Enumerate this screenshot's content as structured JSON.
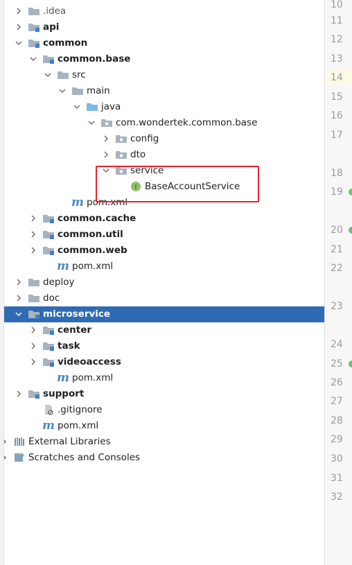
{
  "tree": {
    "rows": [
      {
        "label": ".idea",
        "indent": 0,
        "kind": "dir",
        "state": "collapsed",
        "bold": false,
        "muted": true
      },
      {
        "label": "api",
        "indent": 0,
        "kind": "module",
        "state": "collapsed",
        "bold": true
      },
      {
        "label": "common",
        "indent": 0,
        "kind": "module",
        "state": "expanded",
        "bold": true
      },
      {
        "label": "common.base",
        "indent": 1,
        "kind": "module",
        "state": "expanded",
        "bold": true
      },
      {
        "label": "src",
        "indent": 2,
        "kind": "dir",
        "state": "expanded",
        "bold": false
      },
      {
        "label": "main",
        "indent": 3,
        "kind": "dir",
        "state": "expanded",
        "bold": false
      },
      {
        "label": "java",
        "indent": 4,
        "kind": "source-root",
        "state": "expanded",
        "bold": false
      },
      {
        "label": "com.wondertek.common.base",
        "indent": 5,
        "kind": "package",
        "state": "expanded",
        "bold": false
      },
      {
        "label": "config",
        "indent": 6,
        "kind": "package",
        "state": "collapsed",
        "bold": false
      },
      {
        "label": "dto",
        "indent": 6,
        "kind": "package",
        "state": "collapsed",
        "bold": false
      },
      {
        "label": "service",
        "indent": 6,
        "kind": "package",
        "state": "expanded",
        "bold": false
      },
      {
        "label": "BaseAccountService",
        "indent": 7,
        "kind": "interface",
        "state": "leaf",
        "bold": false
      },
      {
        "label": "pom.xml",
        "indent": 3,
        "kind": "maven",
        "state": "leaf",
        "bold": false
      },
      {
        "label": "common.cache",
        "indent": 1,
        "kind": "module",
        "state": "collapsed",
        "bold": true
      },
      {
        "label": "common.util",
        "indent": 1,
        "kind": "module",
        "state": "collapsed",
        "bold": true
      },
      {
        "label": "common.web",
        "indent": 1,
        "kind": "module",
        "state": "collapsed",
        "bold": true
      },
      {
        "label": "pom.xml",
        "indent": 2,
        "kind": "maven",
        "state": "leaf",
        "bold": false
      },
      {
        "label": "deploy",
        "indent": 0,
        "kind": "dir",
        "state": "collapsed",
        "bold": false
      },
      {
        "label": "doc",
        "indent": 0,
        "kind": "dir",
        "state": "collapsed",
        "bold": false
      },
      {
        "label": "microservice",
        "indent": 0,
        "kind": "module",
        "state": "expanded",
        "bold": true,
        "selected": true
      },
      {
        "label": "center",
        "indent": 1,
        "kind": "module",
        "state": "collapsed",
        "bold": true
      },
      {
        "label": "task",
        "indent": 1,
        "kind": "module",
        "state": "collapsed",
        "bold": true
      },
      {
        "label": "videoaccess",
        "indent": 1,
        "kind": "module",
        "state": "collapsed",
        "bold": true
      },
      {
        "label": "pom.xml",
        "indent": 2,
        "kind": "maven",
        "state": "leaf",
        "bold": false
      },
      {
        "label": "support",
        "indent": 0,
        "kind": "module",
        "state": "collapsed",
        "bold": true
      },
      {
        "label": ".gitignore",
        "indent": 1,
        "kind": "ignore",
        "state": "leaf",
        "bold": false
      },
      {
        "label": "pom.xml",
        "indent": 1,
        "kind": "maven",
        "state": "leaf",
        "bold": false
      },
      {
        "label": "External Libraries",
        "indent": -1,
        "kind": "libraries",
        "state": "collapsed",
        "bold": false
      },
      {
        "label": "Scratches and Consoles",
        "indent": -1,
        "kind": "scratches",
        "state": "collapsed",
        "bold": false
      }
    ]
  },
  "gutter": {
    "lines": [
      "10",
      "11",
      "12",
      "13",
      "14",
      "15",
      "16",
      "17",
      "18",
      "19",
      "20",
      "21",
      "22",
      "23",
      "24",
      "25",
      "26",
      "27",
      "28",
      "29",
      "30",
      "31",
      "32"
    ],
    "current_line": "14",
    "marked_lines": [
      "19",
      "20",
      "25"
    ]
  },
  "colors": {
    "selection": "#2f6bb4",
    "highlight_box": "#e8232c",
    "folder": "#a9b3bd",
    "source_root": "#7fb8e6",
    "module_badge": "#3d7fcf",
    "interface_icon": "#8fbf6a",
    "maven": "#4e86c9"
  }
}
